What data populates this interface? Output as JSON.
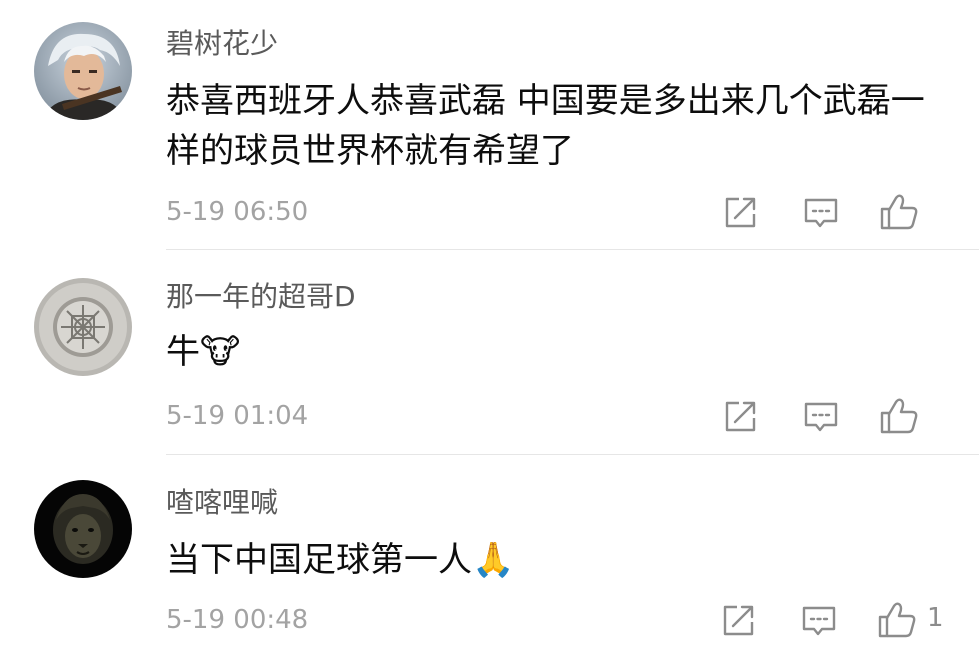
{
  "comments": [
    {
      "username": "碧树花少",
      "text": "恭喜西班牙人恭喜武磊 中国要是多出来几个武磊一样的球员世界杯就有希望了",
      "time": "5-19 06:50",
      "avatar_icon": "user-photo-avatar",
      "likes": ""
    },
    {
      "username": "那一年的超哥D",
      "text": "牛🐮",
      "time": "5-19 01:04",
      "avatar_icon": "stone-window-avatar",
      "likes": ""
    },
    {
      "username": "喳喀哩喊",
      "text": "当下中国足球第一人🙏",
      "time": "5-19 00:48",
      "avatar_icon": "lion-avatar",
      "likes": "1"
    }
  ],
  "icons": {
    "share": "share-icon",
    "reply": "comment-icon",
    "like": "thumbs-up-icon"
  },
  "colors": {
    "username": "#5a5a5a",
    "text": "#0d0d0d",
    "meta": "#a3a3a3",
    "icon": "#8c8c8c",
    "divider": "#e6e6e6"
  }
}
